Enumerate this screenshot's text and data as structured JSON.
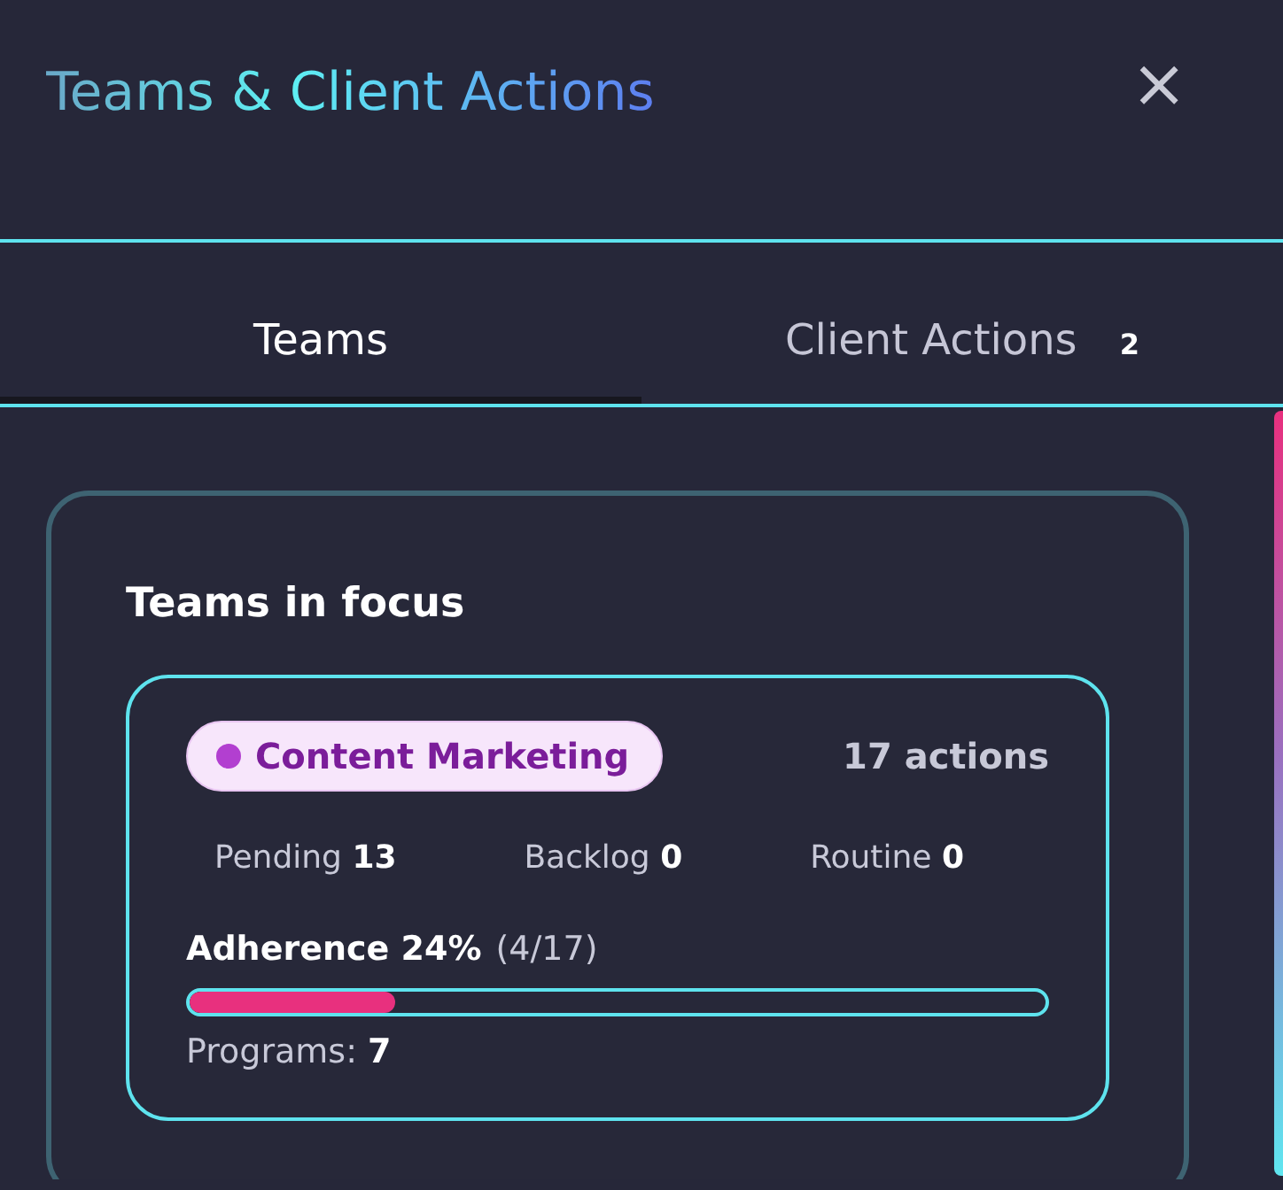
{
  "header": {
    "title": "Teams & Client Actions",
    "close": "×"
  },
  "tabs": [
    {
      "label": "Teams",
      "selected": true
    },
    {
      "label": "Client Actions",
      "selected": false,
      "count": "2"
    }
  ],
  "section": {
    "title": "Teams in focus",
    "teams": [
      {
        "tag": "Content Marketing",
        "color": "#b23fd0",
        "actions": "17 actions",
        "stats": [
          {
            "label": "Pending",
            "value": "13"
          },
          {
            "label": "Backlog",
            "value": "0"
          },
          {
            "label": "Routine",
            "value": "0"
          }
        ],
        "adherence": "Adherence 24%",
        "ratio": "(4/17)",
        "level": 0.24,
        "programs_label": "Programs:",
        "programs_value": "7"
      }
    ]
  }
}
